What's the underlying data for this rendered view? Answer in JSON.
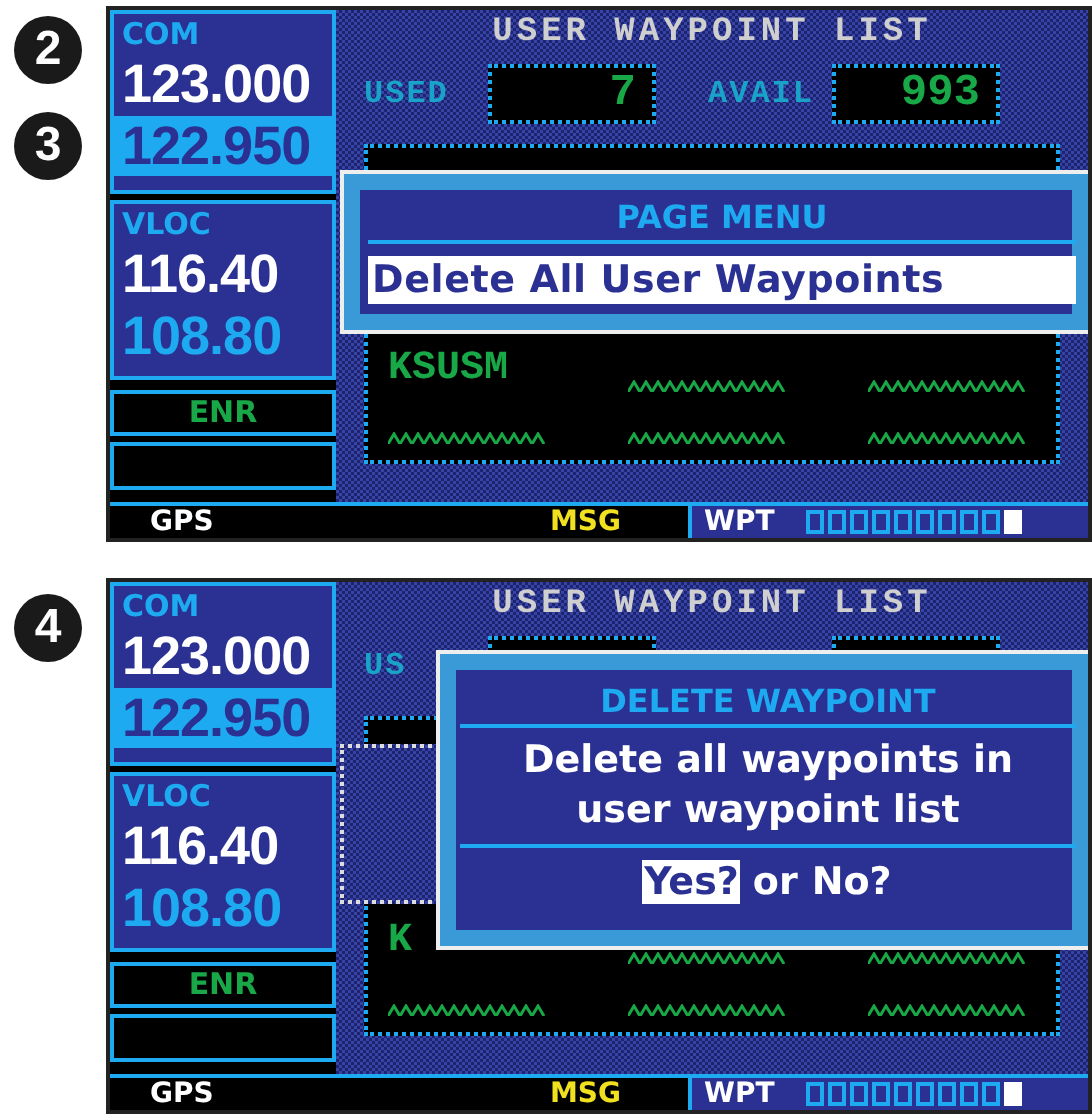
{
  "screens": [
    {
      "callouts": [
        "2",
        "3"
      ],
      "com": {
        "label": "COM",
        "active": "123.000",
        "standby": "122.950",
        "selected": true
      },
      "vloc": {
        "label": "VLOC",
        "active": "116.40",
        "standby": "108.80"
      },
      "mode": "ENR",
      "title": "USER WAYPOINT LIST",
      "used": {
        "label": "USED",
        "value": "7"
      },
      "avail": {
        "label": "AVAIL",
        "value": "993"
      },
      "rows": [
        {
          "name": "KSUSM"
        },
        {
          "name": null
        }
      ],
      "status": {
        "left": "GPS",
        "msg": "MSG",
        "group": "WPT",
        "pages": [
          {
            "selected": false
          },
          {
            "selected": false
          },
          {
            "selected": false
          },
          {
            "selected": false
          },
          {
            "selected": false
          },
          {
            "selected": false
          },
          {
            "selected": false
          },
          {
            "selected": false
          },
          {
            "selected": false
          },
          {
            "selected": true
          }
        ]
      },
      "popup": {
        "kind": "menu",
        "title": "PAGE MENU",
        "items": [
          {
            "label": "Delete All User Waypoints",
            "selected": true
          }
        ]
      }
    },
    {
      "callouts": [
        "4"
      ],
      "com": {
        "label": "COM",
        "active": "123.000",
        "standby": "122.950",
        "selected": true
      },
      "vloc": {
        "label": "VLOC",
        "active": "116.40",
        "standby": "108.80"
      },
      "mode": "ENR",
      "title": "USER WAYPOINT LIST",
      "used": {
        "label": "US"
      },
      "rows": [
        {
          "name": "K"
        },
        {
          "name": null
        }
      ],
      "menu_behind": true,
      "status": {
        "left": "GPS",
        "msg": "MSG",
        "group": "WPT",
        "pages": [
          {
            "selected": false
          },
          {
            "selected": false
          },
          {
            "selected": false
          },
          {
            "selected": false
          },
          {
            "selected": false
          },
          {
            "selected": false
          },
          {
            "selected": false
          },
          {
            "selected": false
          },
          {
            "selected": false
          },
          {
            "selected": true
          }
        ]
      },
      "popup": {
        "kind": "confirm",
        "title": "DELETE WAYPOINT",
        "message": "Delete all waypoints in user waypoint list",
        "options": [
          {
            "label": "Yes?",
            "selected": true
          },
          {
            "label": "No?",
            "selected": false
          }
        ],
        "joiner": "or"
      }
    }
  ]
}
